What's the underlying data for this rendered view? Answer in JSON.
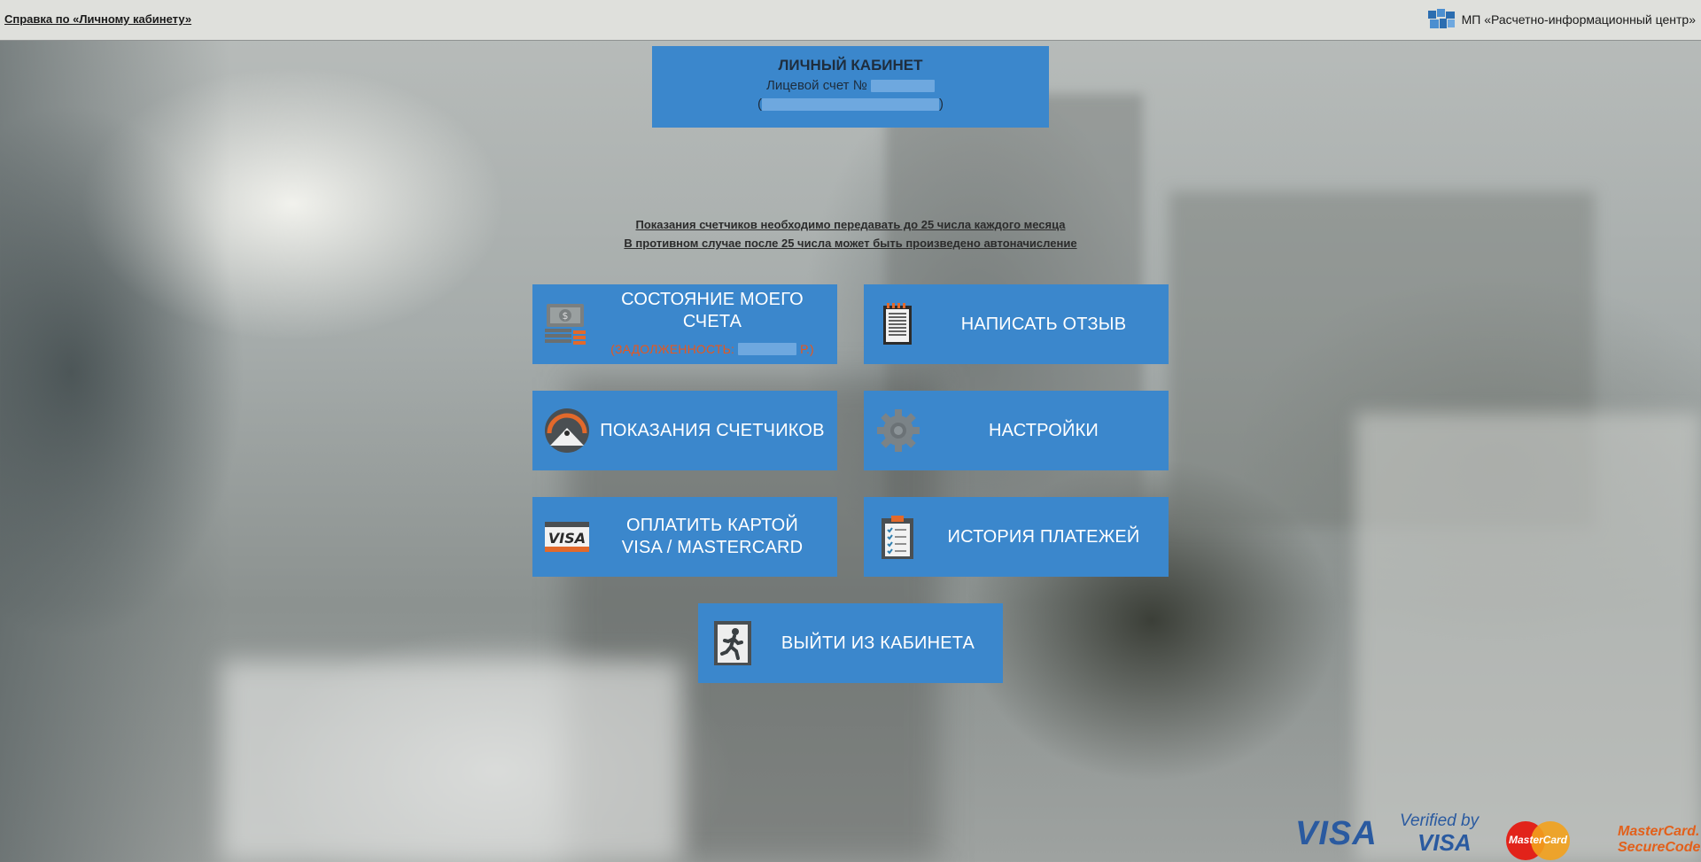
{
  "header": {
    "help_link": "Справка по «Личному кабинету»",
    "organization": "МП «Расчетно-информационный центр»",
    "organization_logo": "ric-logo"
  },
  "account": {
    "title": "ЛИЧНЫЙ КАБИНЕТ",
    "account_label": "Лицевой счет №",
    "open_paren": "(",
    "close_paren": ")"
  },
  "notice": {
    "line1": "Показания счетчиков необходимо передавать до 25 числа каждого месяца",
    "line2": "В противном случае после 25 числа может быть произведено автоначисление"
  },
  "tiles": {
    "account_status": {
      "label": "СОСТОЯНИЕ МОЕГО СЧЕТА",
      "debt_prefix": "(ЗАДОЛЖЕННОСТЬ:",
      "debt_suffix": "Р.)",
      "icon": "money-stack-icon"
    },
    "write_review": {
      "label": "НАПИСАТЬ ОТЗЫВ",
      "icon": "notepad-icon"
    },
    "meter_readings": {
      "label": "ПОКАЗАНИЯ СЧЕТЧИКОВ",
      "icon": "gauge-icon"
    },
    "settings": {
      "label": "НАСТРОЙКИ",
      "icon": "gear-icon"
    },
    "pay_card": {
      "label_line1": "ОПЛАТИТЬ КАРТОЙ",
      "label_line2": "VISA / MASTERCARD",
      "icon": "visa-card-icon"
    },
    "payment_history": {
      "label": "ИСТОРИЯ ПЛАТЕЖЕЙ",
      "icon": "checklist-icon"
    },
    "logout": {
      "label": "ВЫЙТИ ИЗ КАБИНЕТА",
      "icon": "exit-icon"
    }
  },
  "payment_logos": {
    "visa": "VISA",
    "verified_by": "Verified by",
    "verified_visa": "VISA",
    "mastercard": "MasterCard",
    "securecode_line1": "MasterCard.",
    "securecode_line2": "SecureCode."
  },
  "colors": {
    "tile": "#3b87cc",
    "debt": "#e8571c",
    "topbar": "#dfe0dc"
  }
}
